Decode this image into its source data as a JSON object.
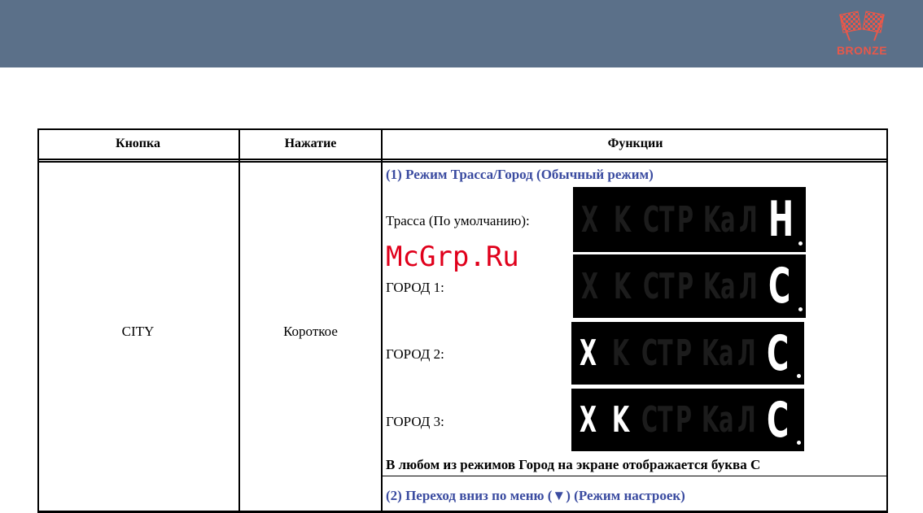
{
  "header": {
    "logo_text": "BRONZE"
  },
  "table": {
    "columns": [
      "Кнопка",
      "Нажатие",
      "Функции"
    ],
    "row": {
      "button": "CITY",
      "press": "Короткое",
      "section1_title": "(1) Режим Трасса/Город (Обычный режим)",
      "modes": [
        {
          "label": "Трасса (По умолчанию):",
          "display": {
            "chars": [
              "X",
              "K",
              "CT",
              "P",
              "Ka",
              "Л"
            ],
            "lit": [
              false,
              false,
              false,
              false,
              false,
              false
            ],
            "letter": "H"
          }
        },
        {
          "label": "ГОРОД 1:",
          "display": {
            "chars": [
              "X",
              "K",
              "CT",
              "P",
              "Ka",
              "Л"
            ],
            "lit": [
              false,
              false,
              false,
              false,
              false,
              false
            ],
            "letter": "C"
          }
        },
        {
          "label": "ГОРОД 2:",
          "display": {
            "chars": [
              "X",
              "K",
              "CT",
              "P",
              "Ka",
              "Л"
            ],
            "lit": [
              true,
              false,
              false,
              false,
              false,
              false
            ],
            "letter": "C"
          }
        },
        {
          "label": "ГОРОД 3:",
          "display": {
            "chars": [
              "X",
              "K",
              "CT",
              "P",
              "Ka",
              "Л"
            ],
            "lit": [
              true,
              true,
              false,
              false,
              false,
              false
            ],
            "letter": "C"
          }
        }
      ],
      "note": "В любом из режимов Город на экране отображается буква С",
      "section2_title": "(2) Переход вниз по меню (▼) (Режим настроек)"
    }
  },
  "watermark": "McGrp.Ru",
  "colors": {
    "header_bg": "#5b7089",
    "logo": "#e8584a",
    "section_title": "#3a4ba0",
    "watermark": "#e0001b"
  }
}
